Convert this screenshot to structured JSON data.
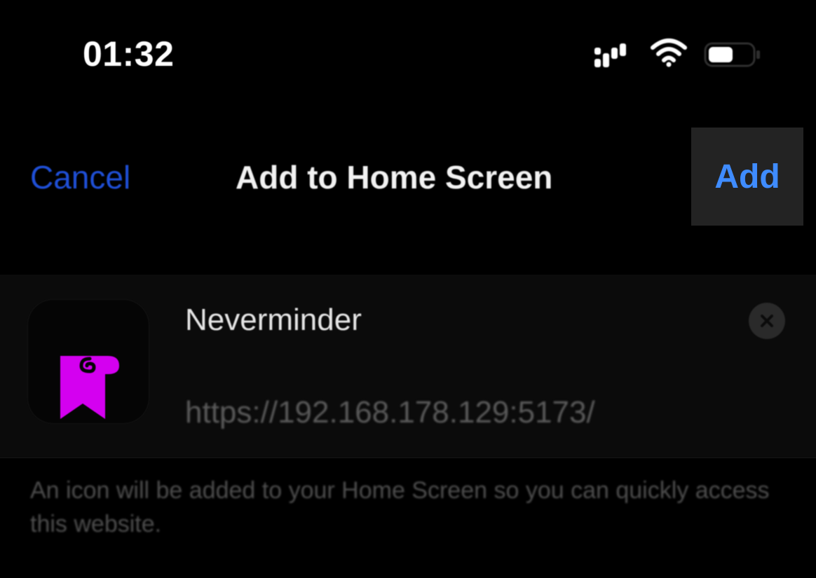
{
  "status_bar": {
    "time": "01:32",
    "icons": [
      "signal-icon",
      "wifi-icon",
      "battery-icon"
    ]
  },
  "nav": {
    "cancel_label": "Cancel",
    "title": "Add to Home Screen",
    "add_label": "Add"
  },
  "card": {
    "app_icon": "bookmark-ribbon-icon",
    "name_value": "Neverminder",
    "url": "https://192.168.178.129:5173/"
  },
  "description": "An icon will be added to your Home Screen so you can quickly access this website.",
  "colors": {
    "background": "#000000",
    "cancel": "#1f4fd6",
    "add": "#3f8cff",
    "add_bg": "#232323",
    "app_icon_accent": "#d400f0",
    "secondary_text": "#5a5a5a"
  }
}
